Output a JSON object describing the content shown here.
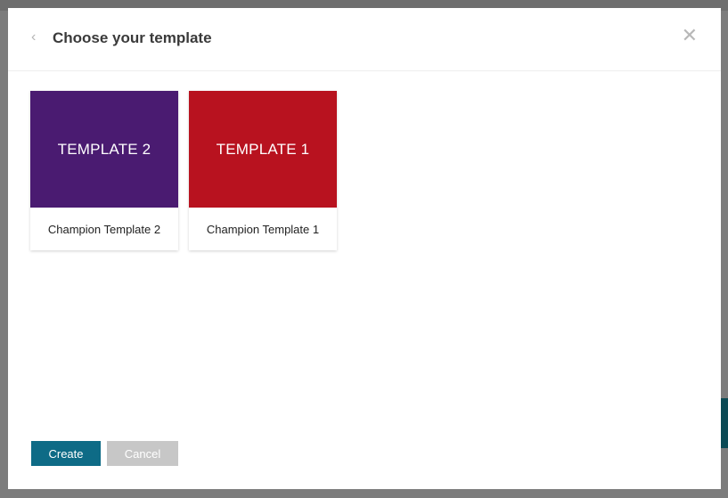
{
  "modal": {
    "title": "Choose your template",
    "back_icon": "chevron-left-icon",
    "close_icon": "close-icon"
  },
  "templates": [
    {
      "thumb_label": "TEMPLATE 2",
      "name": "Champion Template 2",
      "color": "#4a1b71"
    },
    {
      "thumb_label": "TEMPLATE 1",
      "name": "Champion Template 1",
      "color": "#b8121f"
    }
  ],
  "footer": {
    "create_label": "Create",
    "cancel_label": "Cancel"
  }
}
